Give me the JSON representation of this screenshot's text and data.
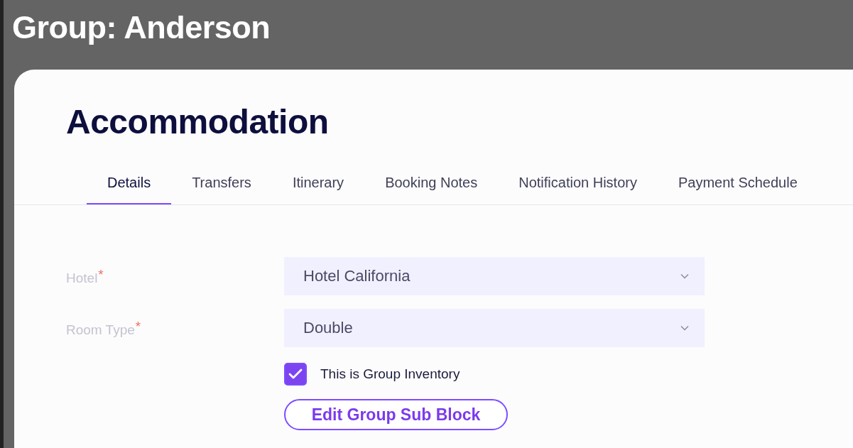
{
  "page_title": "Group: Anderson",
  "heading": "Accommodation",
  "tabs": [
    {
      "label": "Details",
      "selected": true
    },
    {
      "label": "Transfers",
      "selected": false
    },
    {
      "label": "Itinerary",
      "selected": false
    },
    {
      "label": "Booking Notes",
      "selected": false
    },
    {
      "label": "Notification History",
      "selected": false
    },
    {
      "label": "Payment Schedule",
      "selected": false
    }
  ],
  "fields": [
    {
      "label": "Hotel",
      "required_mark": "*",
      "value": "Hotel California"
    },
    {
      "label": "Room Type",
      "required_mark": "*",
      "value": "Double"
    }
  ],
  "checkbox": {
    "label": "This is Group Inventory",
    "checked": true
  },
  "button": "Edit Group Sub Block"
}
